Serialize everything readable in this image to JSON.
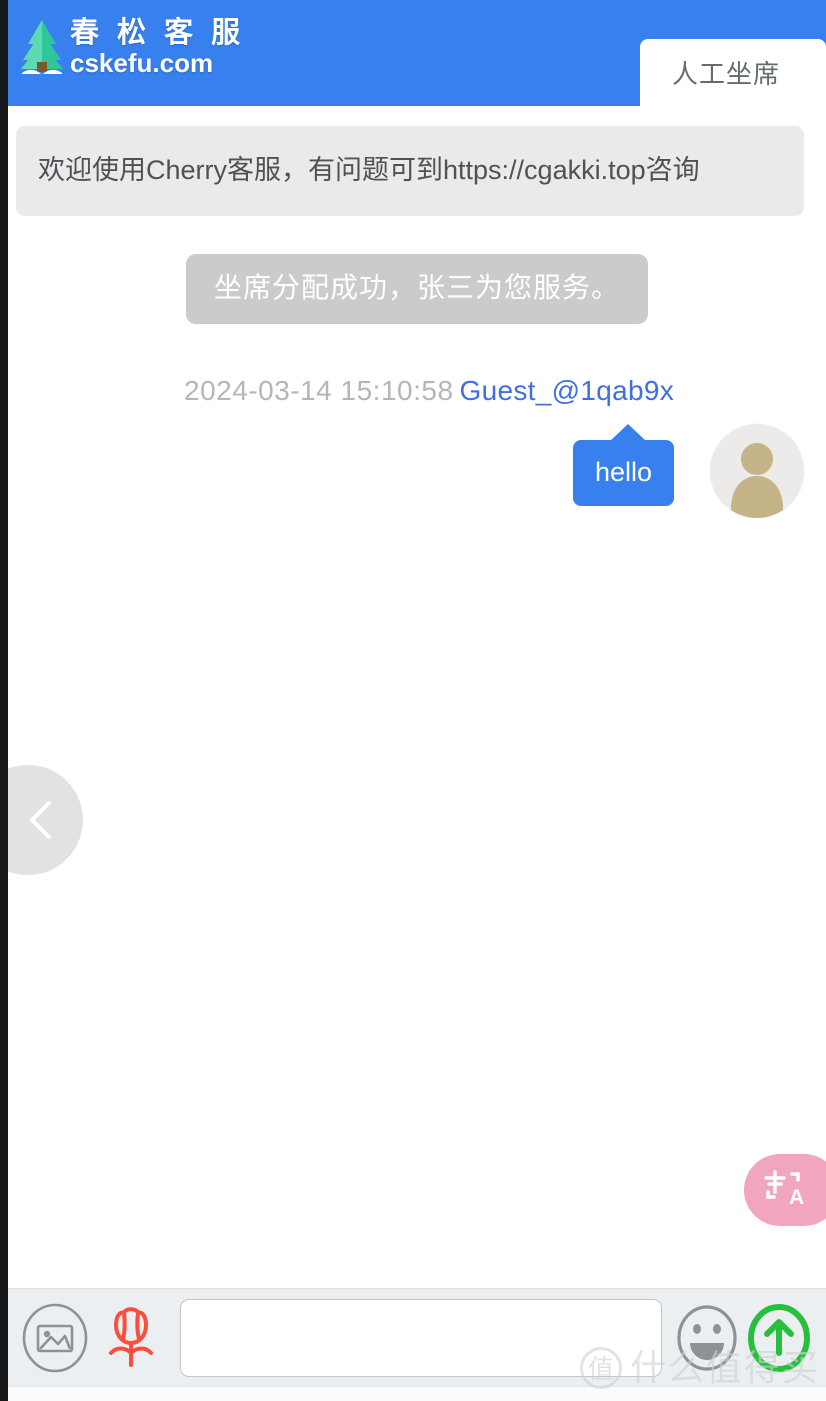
{
  "colors": {
    "header_blue": "#3880ee",
    "bubble_blue": "#3880ee",
    "system_gray": "#c9cbcc",
    "banner_gray": "#eaeaea",
    "toolbar_gray": "#eceff1",
    "translate_pink": "#f2a6bd",
    "send_green": "#27bf3c",
    "flower_red": "#f8503c",
    "username_blue": "#3f6fe0",
    "edge_black": "#17181a"
  },
  "header": {
    "logo_icon": "pine-tree-icon",
    "brand_cn": "春 松 客 服",
    "brand_domain": "cskefu.com",
    "agent_tab_label": "人工坐席"
  },
  "chat": {
    "welcome_banner": "欢迎使用Cherry客服，有问题可到https://cgakki.top咨询",
    "system_message": "坐席分配成功，张三为您服务。",
    "messages": [
      {
        "timestamp": "2024-03-14 15:10:58",
        "username": "Guest_@1qab9x",
        "text": "hello",
        "avatar": "default-user-avatar",
        "side": "right"
      }
    ]
  },
  "floating": {
    "back_icon": "chevron-left-icon",
    "translate_icon": "translate-icon",
    "translate_glyph_cn": "中",
    "translate_glyph_en": "A"
  },
  "toolbar": {
    "image_icon": "image-picture-icon",
    "flower_icon": "flower-tulip-icon",
    "input_value": "",
    "input_placeholder": "",
    "emoji_icon": "smiley-face-icon",
    "send_icon": "send-arrow-up-icon"
  },
  "watermark": {
    "badge": "值",
    "text": "什么值得买"
  }
}
